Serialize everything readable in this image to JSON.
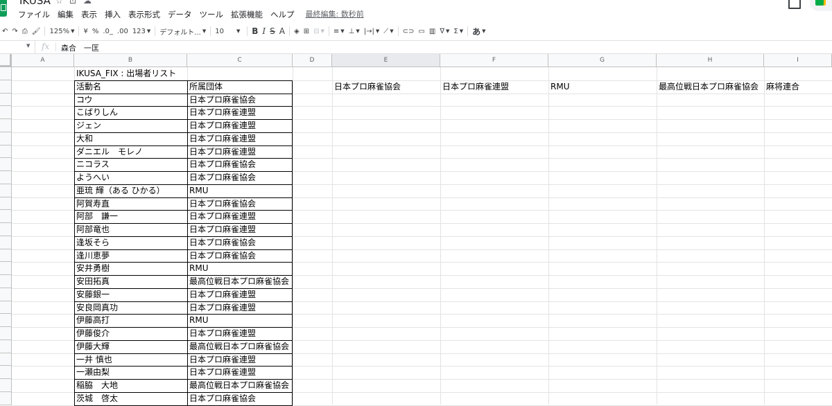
{
  "app": {
    "title": "IKUSA",
    "menu": [
      "ファイル",
      "編集",
      "表示",
      "挿入",
      "表示形式",
      "データ",
      "ツール",
      "拡張機能",
      "ヘルプ"
    ],
    "last_edit": "最終編集: 数秒前"
  },
  "toolbar": {
    "zoom": "125%",
    "currency": "¥",
    "percent": "%",
    "decimal_decrease": ".0_",
    "decimal_increase": ".00",
    "number_format": "123",
    "font": "デフォルト...",
    "font_size": "10",
    "bold": "B",
    "italic": "I",
    "strike": "S",
    "text_color": "A",
    "input_tools": "あ"
  },
  "formula_bar": {
    "fx": "fx",
    "content": "森合　一匡"
  },
  "columns": [
    "A",
    "B",
    "C",
    "D",
    "E",
    "F",
    "G",
    "H",
    "I"
  ],
  "sheet": {
    "title": "IKUSA_FIX : 出場者リスト",
    "headers": [
      "活動名",
      "所属団体"
    ],
    "orgs": [
      "日本プロ麻雀協会",
      "日本プロ麻雀連盟",
      "RMU",
      "最高位戦日本プロ麻雀協会",
      "麻将連合"
    ],
    "rows": [
      [
        "コウ",
        "日本プロ麻雀協会"
      ],
      [
        "こばりしん",
        "日本プロ麻雀連盟"
      ],
      [
        "ジェン",
        "日本プロ麻雀連盟"
      ],
      [
        "大和",
        "日本プロ麻雀連盟"
      ],
      [
        "ダニエル　モレノ",
        "日本プロ麻雀連盟"
      ],
      [
        "ニコラス",
        "日本プロ麻雀協会"
      ],
      [
        "ようへい",
        "日本プロ麻雀協会"
      ],
      [
        "亜琉 輝（ある ひかる）",
        "RMU"
      ],
      [
        "阿賀寿直",
        "日本プロ麻雀協会"
      ],
      [
        "阿部　謙一",
        "日本プロ麻雀連盟"
      ],
      [
        "阿部竜也",
        "日本プロ麻雀連盟"
      ],
      [
        "逢坂そら",
        "日本プロ麻雀協会"
      ],
      [
        "逢川恵夢",
        "日本プロ麻雀協会"
      ],
      [
        "安井勇樹",
        "RMU"
      ],
      [
        "安田拓真",
        "最高位戦日本プロ麻雀協会"
      ],
      [
        "安藤銀一",
        "日本プロ麻雀連盟"
      ],
      [
        "安良岡真功",
        "日本プロ麻雀連盟"
      ],
      [
        "伊藤高打",
        "RMU"
      ],
      [
        "伊藤俊介",
        "日本プロ麻雀連盟"
      ],
      [
        "伊藤大輝",
        "最高位戦日本プロ麻雀協会"
      ],
      [
        "一井 慎也",
        "日本プロ麻雀連盟"
      ],
      [
        "一瀬由梨",
        "日本プロ麻雀連盟"
      ],
      [
        "稲脇　大地",
        "最高位戦日本プロ麻雀協会"
      ],
      [
        "茨城　啓太",
        "日本プロ麻雀協会"
      ]
    ]
  }
}
